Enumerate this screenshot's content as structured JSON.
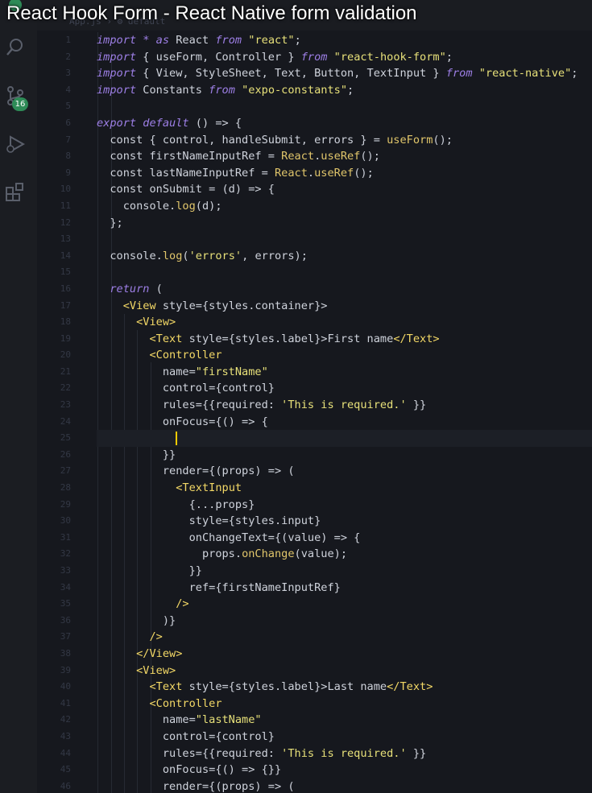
{
  "video": {
    "title": "React Hook Form - React Native form validation"
  },
  "tab": {
    "breadcrumb": "App.js › ⚙ default"
  },
  "activity_bar": {
    "icons": [
      "explorer-icon",
      "search-icon",
      "source-control-icon",
      "debug-icon",
      "extensions-icon"
    ],
    "scm_badge": "16"
  },
  "colors": {
    "background": "#16181e",
    "keyword": "#9d7fe6",
    "string": "#e7e079",
    "tag": "#f3d866",
    "cursor": "#ffcc00"
  },
  "gutter": [
    "1",
    "2",
    "3",
    "4",
    "5",
    "6",
    "7",
    "8",
    "9",
    "10",
    "11",
    "12",
    "13",
    "14",
    "15",
    "16",
    "17",
    "18",
    "19",
    "20",
    "21",
    "22",
    "23",
    "24",
    "25",
    "26",
    "27",
    "28",
    "29",
    "30",
    "31",
    "32",
    "33",
    "34",
    "35",
    "36",
    "37",
    "38",
    "39",
    "40",
    "41",
    "42",
    "43",
    "44",
    "45",
    "46"
  ],
  "code": [
    [
      [
        "kw",
        "import"
      ],
      [
        "pl",
        " "
      ],
      [
        "kw",
        "*"
      ],
      [
        "pl",
        " "
      ],
      [
        "kw",
        "as"
      ],
      [
        "pl",
        " React "
      ],
      [
        "kw",
        "from"
      ],
      [
        "pl",
        " "
      ],
      [
        "str",
        "\"react\""
      ],
      [
        "pl",
        ";"
      ]
    ],
    [
      [
        "kw",
        "import"
      ],
      [
        "pl",
        " { useForm, Controller } "
      ],
      [
        "kw",
        "from"
      ],
      [
        "pl",
        " "
      ],
      [
        "str",
        "\"react-hook-form\""
      ],
      [
        "pl",
        ";"
      ]
    ],
    [
      [
        "kw",
        "import"
      ],
      [
        "pl",
        " { View, StyleSheet, Text, Button, TextInput } "
      ],
      [
        "kw",
        "from"
      ],
      [
        "pl",
        " "
      ],
      [
        "str",
        "\"react-native\""
      ],
      [
        "pl",
        ";"
      ]
    ],
    [
      [
        "kw",
        "import"
      ],
      [
        "pl",
        " Constants "
      ],
      [
        "kw",
        "from"
      ],
      [
        "pl",
        " "
      ],
      [
        "str",
        "\"expo-constants\""
      ],
      [
        "pl",
        ";"
      ]
    ],
    [],
    [
      [
        "kw",
        "export"
      ],
      [
        "pl",
        " "
      ],
      [
        "kw",
        "default"
      ],
      [
        "pl",
        " () => {"
      ]
    ],
    [
      [
        "pl",
        "  const { control, handleSubmit, errors } = "
      ],
      [
        "fn",
        "useForm"
      ],
      [
        "br",
        "()"
      ],
      [
        "pl",
        ";"
      ]
    ],
    [
      [
        "pl",
        "  const firstNameInputRef = "
      ],
      [
        "fn",
        "React"
      ],
      [
        "pl",
        "."
      ],
      [
        "fn",
        "useRef"
      ],
      [
        "br",
        "()"
      ],
      [
        "pl",
        ";"
      ]
    ],
    [
      [
        "pl",
        "  const lastNameInputRef = "
      ],
      [
        "fn",
        "React"
      ],
      [
        "pl",
        "."
      ],
      [
        "fn",
        "useRef"
      ],
      [
        "br",
        "()"
      ],
      [
        "pl",
        ";"
      ]
    ],
    [
      [
        "pl",
        "  const onSubmit = (d) => {"
      ]
    ],
    [
      [
        "pl",
        "    console."
      ],
      [
        "fn",
        "log"
      ],
      [
        "pl",
        "(d);"
      ]
    ],
    [
      [
        "pl",
        "  };"
      ]
    ],
    [],
    [
      [
        "pl",
        "  console."
      ],
      [
        "fn",
        "log"
      ],
      [
        "pl",
        "("
      ],
      [
        "str",
        "'errors'"
      ],
      [
        "pl",
        ", errors);"
      ]
    ],
    [],
    [
      [
        "pl",
        "  "
      ],
      [
        "kw",
        "return"
      ],
      [
        "pl",
        " ("
      ]
    ],
    [
      [
        "pl",
        "    "
      ],
      [
        "tag",
        "<View"
      ],
      [
        "pl",
        " style={styles.container}>"
      ]
    ],
    [
      [
        "pl",
        "      "
      ],
      [
        "tag",
        "<View>"
      ]
    ],
    [
      [
        "pl",
        "        "
      ],
      [
        "tag",
        "<Text"
      ],
      [
        "pl",
        " style={styles.label}>First name"
      ],
      [
        "tag",
        "</Text>"
      ]
    ],
    [
      [
        "pl",
        "        "
      ],
      [
        "tag",
        "<Controller"
      ]
    ],
    [
      [
        "pl",
        "          name="
      ],
      [
        "str",
        "\"firstName\""
      ]
    ],
    [
      [
        "pl",
        "          control={control}"
      ]
    ],
    [
      [
        "pl",
        "          rules={{required: "
      ],
      [
        "str",
        "'This is required.'"
      ],
      [
        "pl",
        " }}"
      ]
    ],
    [
      [
        "pl",
        "          onFocus={() => {"
      ]
    ],
    [
      [
        "pl",
        "            "
      ],
      [
        "caret",
        ""
      ]
    ],
    [
      [
        "pl",
        "          }}"
      ]
    ],
    [
      [
        "pl",
        "          render={(props) => ("
      ]
    ],
    [
      [
        "pl",
        "            "
      ],
      [
        "tag",
        "<TextInput"
      ]
    ],
    [
      [
        "pl",
        "              {...props}"
      ]
    ],
    [
      [
        "pl",
        "              style={styles.input}"
      ]
    ],
    [
      [
        "pl",
        "              onChangeText={(value) => {"
      ]
    ],
    [
      [
        "pl",
        "                props."
      ],
      [
        "fn",
        "onChange"
      ],
      [
        "pl",
        "(value);"
      ]
    ],
    [
      [
        "pl",
        "              }}"
      ]
    ],
    [
      [
        "pl",
        "              ref={firstNameInputRef}"
      ]
    ],
    [
      [
        "pl",
        "            "
      ],
      [
        "tag",
        "/>"
      ]
    ],
    [
      [
        "pl",
        "          )}"
      ]
    ],
    [
      [
        "pl",
        "        "
      ],
      [
        "tag",
        "/>"
      ]
    ],
    [
      [
        "pl",
        "      "
      ],
      [
        "tag",
        "</View>"
      ]
    ],
    [
      [
        "pl",
        "      "
      ],
      [
        "tag",
        "<View>"
      ]
    ],
    [
      [
        "pl",
        "        "
      ],
      [
        "tag",
        "<Text"
      ],
      [
        "pl",
        " style={styles.label}>Last name"
      ],
      [
        "tag",
        "</Text>"
      ]
    ],
    [
      [
        "pl",
        "        "
      ],
      [
        "tag",
        "<Controller"
      ]
    ],
    [
      [
        "pl",
        "          name="
      ],
      [
        "str",
        "\"lastName\""
      ]
    ],
    [
      [
        "pl",
        "          control={control}"
      ]
    ],
    [
      [
        "pl",
        "          rules={{required: "
      ],
      [
        "str",
        "'This is required.'"
      ],
      [
        "pl",
        " }}"
      ]
    ],
    [
      [
        "pl",
        "          onFocus={() => {}}"
      ]
    ],
    [
      [
        "pl",
        "          render={(props) => ("
      ]
    ]
  ]
}
